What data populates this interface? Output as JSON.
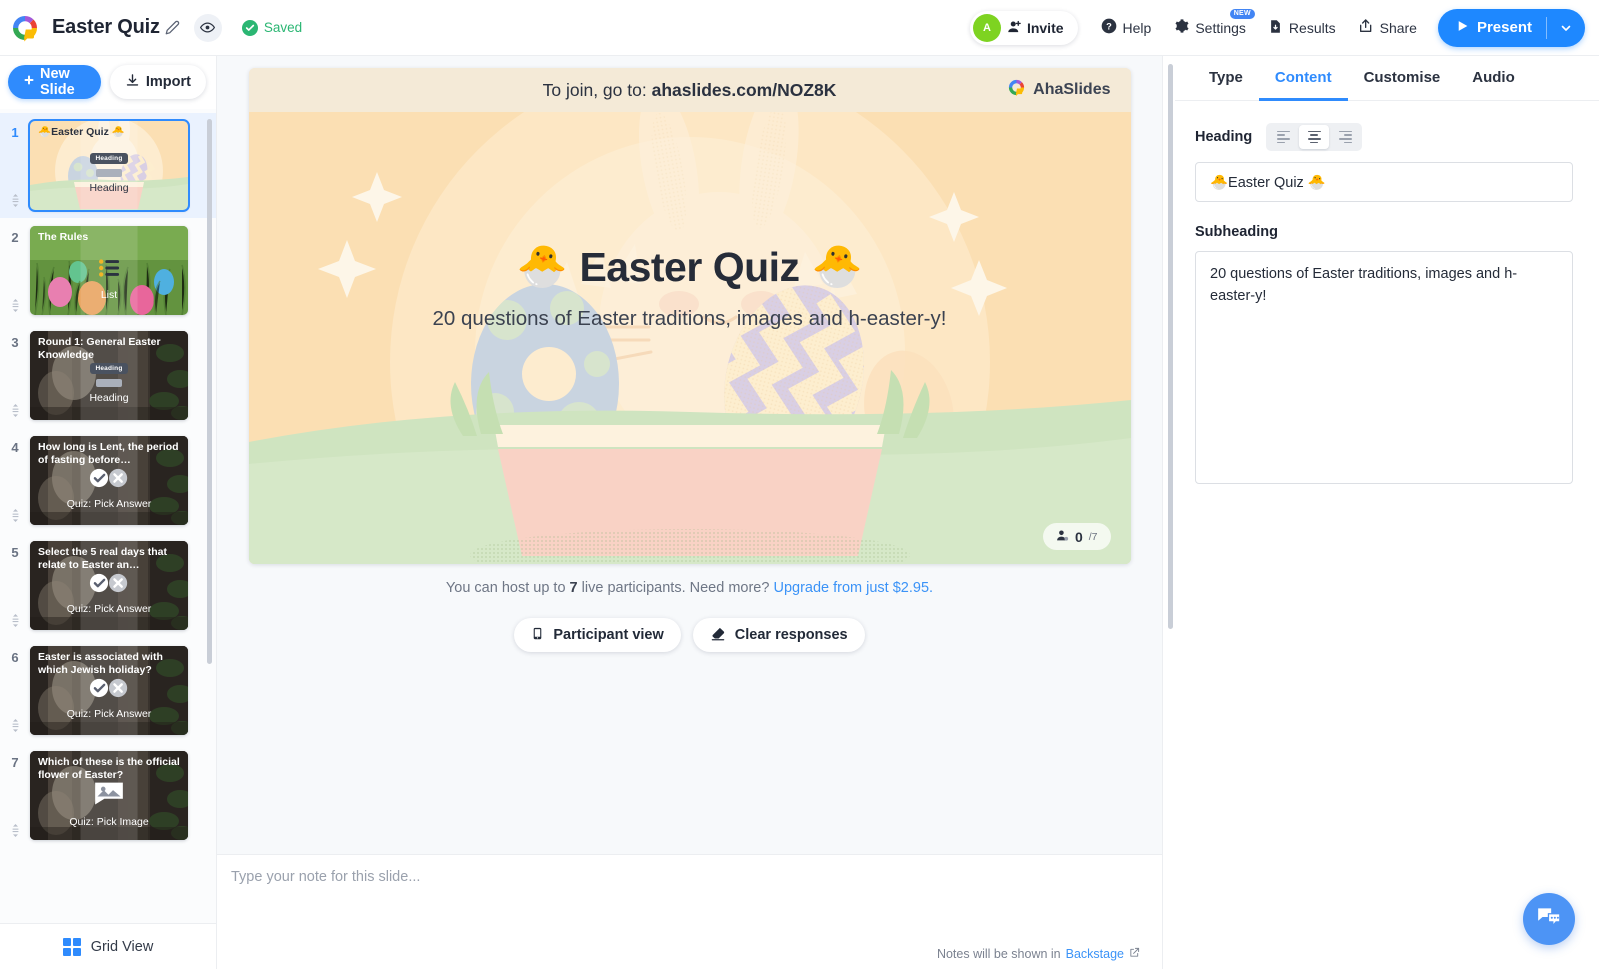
{
  "topbar": {
    "logo_icon": "ahaslides-logo-icon",
    "doc_title": "Easter Quiz",
    "edit_icon": "pencil-icon",
    "preview_icon": "eye-icon",
    "saved_label": "Saved",
    "saved_color": "#2bb673",
    "avatar_initial": "A",
    "avatar_color": "#7ed321",
    "invite_label": "Invite",
    "help_label": "Help",
    "settings_label": "Settings",
    "settings_badge": "NEW",
    "results_label": "Results",
    "share_label": "Share",
    "present_label": "Present",
    "present_color": "#1e88ff"
  },
  "sidebar": {
    "new_slide_label": "New Slide",
    "import_label": "Import",
    "grid_view_label": "Grid View",
    "slides": [
      {
        "num": "1",
        "title": "🐣Easter Quiz 🐣",
        "type_label": "Heading",
        "chip_label": "Heading",
        "theme": "easter",
        "title_color": "#2b3240",
        "type_color": "dark",
        "active": true
      },
      {
        "num": "2",
        "title": "The Rules",
        "type_label": "List",
        "chip_label": "",
        "theme": "grass",
        "title_color": "#ffffff",
        "type_color": "light",
        "active": false
      },
      {
        "num": "3",
        "title": "Round 1: General Easter Knowledge",
        "type_label": "Heading",
        "chip_label": "Heading",
        "theme": "dark",
        "title_color": "#ffffff",
        "type_color": "light",
        "active": false
      },
      {
        "num": "4",
        "title": "How long is Lent, the period of fasting before…",
        "type_label": "Quiz: Pick Answer",
        "chip_label": "",
        "theme": "dark",
        "title_color": "#ffffff",
        "type_color": "light",
        "active": false
      },
      {
        "num": "5",
        "title": "Select the 5 real days that relate to Easter an…",
        "type_label": "Quiz: Pick Answer",
        "chip_label": "",
        "theme": "dark",
        "title_color": "#ffffff",
        "type_color": "light",
        "active": false
      },
      {
        "num": "6",
        "title": "Easter is associated with which Jewish holiday?",
        "type_label": "Quiz: Pick Answer",
        "chip_label": "",
        "theme": "dark",
        "title_color": "#ffffff",
        "type_color": "light",
        "active": false
      },
      {
        "num": "7",
        "title": "Which of these is the official flower of Easter?",
        "type_label": "Quiz: Pick Image",
        "chip_label": "",
        "theme": "dark",
        "title_color": "#ffffff",
        "type_color": "light",
        "active": false
      }
    ]
  },
  "slide": {
    "join_prefix": "To join, go to:",
    "join_code": "ahaslides.com/NOZ8K",
    "brand_label": "AhaSlides",
    "heading": "Easter Quiz",
    "heading_emoji_left": "🐣",
    "heading_emoji_right": "🐣",
    "subheading": "20 questions of Easter traditions, images and h-easter-y!",
    "participants_current": "0",
    "participants_max": "/7"
  },
  "below_slide": {
    "upgrade_pre": "You can host up to ",
    "upgrade_limit": "7",
    "upgrade_mid": " live participants. Need more? ",
    "upgrade_link": "Upgrade from just $2.95.",
    "participant_view_label": "Participant view",
    "clear_responses_label": "Clear responses"
  },
  "notes": {
    "placeholder": "Type your note for this slide...",
    "value": "",
    "footer_pre": "Notes will be shown in ",
    "footer_link": "Backstage"
  },
  "right_panel": {
    "tabs": [
      {
        "label": "Type",
        "active": false
      },
      {
        "label": "Content",
        "active": true
      },
      {
        "label": "Customise",
        "active": false
      },
      {
        "label": "Audio",
        "active": false
      }
    ],
    "heading_label": "Heading",
    "heading_value": "🐣Easter Quiz 🐣",
    "subheading_label": "Subheading",
    "subheading_value": "20 questions of Easter traditions, images and h-easter-y!",
    "align_options": [
      "align-left",
      "align-center",
      "align-right"
    ],
    "align_selected": "align-center"
  },
  "chat": {
    "icon": "chat-bubble-icon",
    "color": "#4d94f5"
  }
}
